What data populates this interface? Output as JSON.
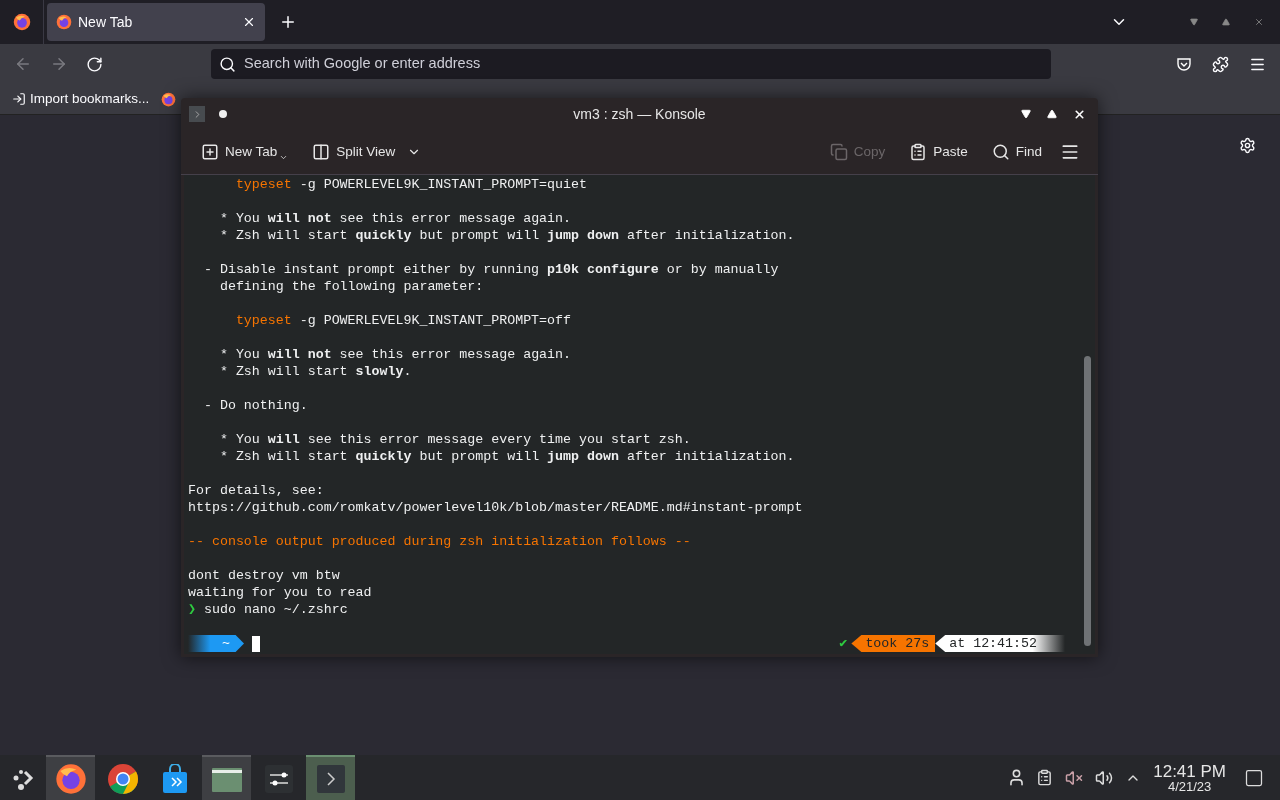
{
  "browser": {
    "tabs": [
      {
        "label": "New Tab",
        "selected": true
      }
    ],
    "toolbar": {
      "back_disabled": true,
      "forward_disabled": true,
      "placeholder": "Search with Google or enter address"
    },
    "bookmarks": [
      {
        "kind": "import",
        "label": "Import bookmarks..."
      },
      {
        "kind": "firefox"
      }
    ]
  },
  "konsole": {
    "title": "vm3 : zsh — Konsole",
    "toolbar": [
      {
        "kind": "new-tab",
        "label": "New Tab",
        "disabled": false
      },
      {
        "kind": "split-view",
        "label": "Split View",
        "disabled": false
      },
      {
        "kind": "copy",
        "label": "Copy",
        "disabled": true
      },
      {
        "kind": "paste",
        "label": "Paste",
        "disabled": false
      },
      {
        "kind": "find",
        "label": "Find",
        "disabled": false
      }
    ],
    "lines": [
      {
        "kind": "command",
        "keyword": "      typeset",
        "text": " -g POWERLEVEL9K_INSTANT_PROMPT=quiet"
      },
      {
        "kind": "blank"
      },
      {
        "kind": "text",
        "text": "    * You **will not** see this error message again."
      },
      {
        "kind": "text",
        "text": "    * Zsh will start **quickly** but prompt will **jump down** after initialization."
      },
      {
        "kind": "blank"
      },
      {
        "kind": "text",
        "text": "  - Disable instant prompt either by running **p10k configure** or by manually"
      },
      {
        "kind": "text",
        "text": "    defining the following parameter:"
      },
      {
        "kind": "blank"
      },
      {
        "kind": "command",
        "keyword": "      typeset",
        "text": " -g POWERLEVEL9K_INSTANT_PROMPT=off"
      },
      {
        "kind": "blank"
      },
      {
        "kind": "text",
        "text": "    * You **will not** see this error message again."
      },
      {
        "kind": "text",
        "text": "    * Zsh will start **slowly**."
      },
      {
        "kind": "blank"
      },
      {
        "kind": "text",
        "text": "  - Do nothing."
      },
      {
        "kind": "blank"
      },
      {
        "kind": "text",
        "text": "    * You **will** see this error message every time you start zsh."
      },
      {
        "kind": "text",
        "text": "    * Zsh will start **quickly** but prompt will **jump down** after initialization."
      },
      {
        "kind": "blank"
      },
      {
        "kind": "text",
        "text": "For details, see:"
      },
      {
        "kind": "text",
        "text": "https://github.com/romkatv/powerlevel10k/blob/master/README.md#instant-prompt"
      },
      {
        "kind": "blank"
      },
      {
        "kind": "warning",
        "text": "-- console output produced during zsh initialization follows --"
      },
      {
        "kind": "blank"
      },
      {
        "kind": "text",
        "text": "dont destroy vm btw"
      },
      {
        "kind": "text",
        "text": "waiting for you to read"
      },
      {
        "kind": "prompt",
        "symbol": "❯",
        "text": "sudo nano ~/.zshrc"
      },
      {
        "kind": "blank"
      }
    ],
    "status": {
      "dir": "~",
      "ok": "✔",
      "took": "took 27s",
      "time": "at 12:41:52"
    }
  },
  "taskbar": {
    "apps": [
      {
        "kind": "firefox",
        "active": true
      },
      {
        "kind": "chrome",
        "active": false
      },
      {
        "kind": "store",
        "active": false
      },
      {
        "kind": "files",
        "active": true
      },
      {
        "kind": "settings",
        "active": false
      },
      {
        "kind": "terminal",
        "active": true
      }
    ],
    "time": "12:41 PM",
    "date": "4/21/23"
  }
}
